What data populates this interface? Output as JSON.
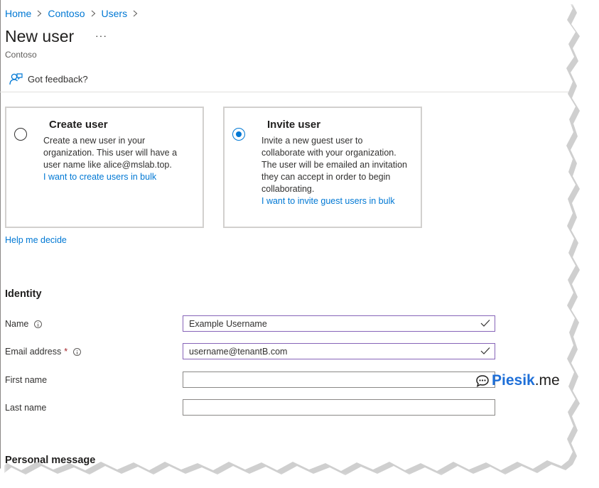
{
  "breadcrumb": {
    "items": [
      "Home",
      "Contoso",
      "Users"
    ]
  },
  "header": {
    "title": "New user",
    "more": "···",
    "subtitle": "Contoso"
  },
  "toolbar": {
    "feedback_label": "Got feedback?"
  },
  "options": {
    "create": {
      "title": "Create user",
      "description": "Create a new user in your organization. This user will have a user name like alice@mslab.top.",
      "link": "I want to create users in bulk",
      "selected": false
    },
    "invite": {
      "title": "Invite user",
      "description": "Invite a new guest user to collaborate with your organization. The user will be emailed an invitation they can accept in order to begin collaborating.",
      "link": "I want to invite guest users in bulk",
      "selected": true
    }
  },
  "help_link": "Help me decide",
  "identity": {
    "heading": "Identity",
    "name_label": "Name",
    "name_value": "Example Username",
    "email_label": "Email address",
    "email_required": "*",
    "email_value": "username@tenantB.com",
    "first_name_label": "First name",
    "first_name_value": "",
    "last_name_label": "Last name",
    "last_name_value": ""
  },
  "personal_message": {
    "heading": "Personal message"
  },
  "watermark": {
    "brand": "Piesik",
    "suffix": ".me"
  },
  "colors": {
    "accent": "#0078d4",
    "valid_border": "#8764b8",
    "required": "#a4262c"
  }
}
